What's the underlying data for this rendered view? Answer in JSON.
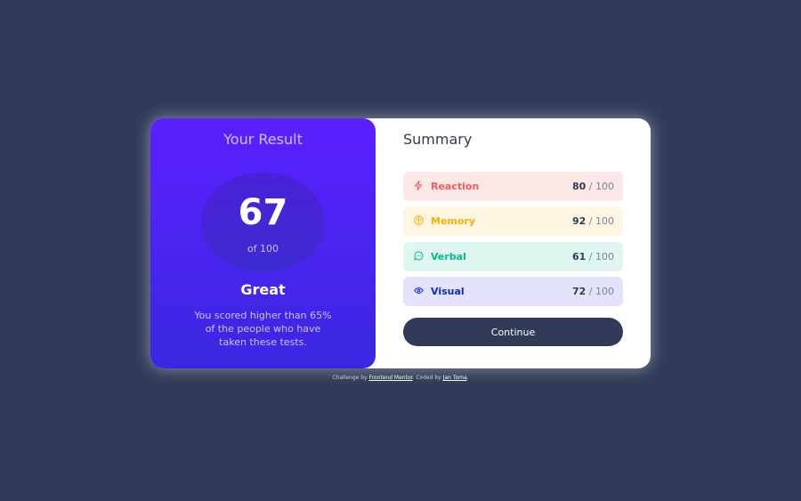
{
  "result": {
    "title": "Your Result",
    "score": "67",
    "of": "of 100",
    "verdict": "Great",
    "description": "You scored higher than 65% of the people who have taken these tests."
  },
  "summary": {
    "title": "Summary",
    "items": [
      {
        "label": "Reaction",
        "score": "80",
        "max": " / 100",
        "icon": "lightning-icon",
        "color": "#f55a5a",
        "bg": "#fde8e8"
      },
      {
        "label": "Memory",
        "score": "92",
        "max": " / 100",
        "icon": "brain-icon",
        "color": "#f5b300",
        "bg": "#fff5e3"
      },
      {
        "label": "Verbal",
        "score": "61",
        "max": " / 100",
        "icon": "chat-icon",
        "color": "#00bb8f",
        "bg": "#e0f6f0"
      },
      {
        "label": "Visual",
        "score": "72",
        "max": " / 100",
        "icon": "eye-icon",
        "color": "#1125d6",
        "bg": "#e3e4fb"
      }
    ],
    "continue_label": "Continue"
  },
  "footer": {
    "prefix": "Challenge by ",
    "link1": "Frontend Mentor",
    "middle": ". Coded by ",
    "link2": "Jan Toma",
    "suffix": "."
  },
  "colors": {
    "page_bg": "#303b58",
    "result_gradient_top": "#5b20ff",
    "result_gradient_bottom": "#3a28e0",
    "button_bg": "#303b58"
  }
}
